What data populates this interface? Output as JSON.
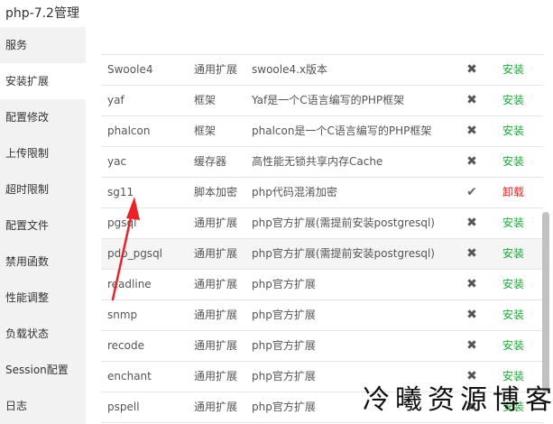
{
  "window": {
    "title": "php-7.2管理"
  },
  "sidebar": {
    "items": [
      {
        "label": "服务",
        "active": false
      },
      {
        "label": "安装扩展",
        "active": true
      },
      {
        "label": "配置修改",
        "active": false
      },
      {
        "label": "上传限制",
        "active": false
      },
      {
        "label": "超时限制",
        "active": false
      },
      {
        "label": "配置文件",
        "active": false
      },
      {
        "label": "禁用函数",
        "active": false
      },
      {
        "label": "性能调整",
        "active": false
      },
      {
        "label": "负载状态",
        "active": false
      },
      {
        "label": "Session配置",
        "active": false
      },
      {
        "label": "日志",
        "active": false
      }
    ]
  },
  "extensions": {
    "rows": [
      {
        "name": "Swoole4",
        "type": "通用扩展",
        "desc": "swoole4.x版本",
        "status_icon": "cross-icon",
        "action": "安装",
        "installed": false
      },
      {
        "name": "yaf",
        "type": "框架",
        "desc": "Yaf是一个C语言编写的PHP框架",
        "status_icon": "cross-icon",
        "action": "安装",
        "installed": false
      },
      {
        "name": "phalcon",
        "type": "框架",
        "desc": "phalcon是一个C语言编写的PHP框架",
        "status_icon": "cross-icon",
        "action": "安装",
        "installed": false
      },
      {
        "name": "yac",
        "type": "缓存器",
        "desc": "高性能无锁共享内存Cache",
        "status_icon": "cross-icon",
        "action": "安装",
        "installed": false
      },
      {
        "name": "sg11",
        "type": "脚本加密",
        "desc": "php代码混淆加密",
        "status_icon": "check-icon",
        "action": "卸载",
        "installed": true
      },
      {
        "name": "pgsql",
        "type": "通用扩展",
        "desc": "php官方扩展(需提前安装postgresql)",
        "status_icon": "cross-icon",
        "action": "安装",
        "installed": false
      },
      {
        "name": "pdo_pgsql",
        "type": "通用扩展",
        "desc": "php官方扩展(需提前安装postgresql)",
        "status_icon": "cross-icon",
        "action": "安装",
        "installed": false
      },
      {
        "name": "readline",
        "type": "通用扩展",
        "desc": "php官方扩展",
        "status_icon": "cross-icon",
        "action": "安装",
        "installed": false
      },
      {
        "name": "snmp",
        "type": "通用扩展",
        "desc": "php官方扩展",
        "status_icon": "cross-icon",
        "action": "安装",
        "installed": false
      },
      {
        "name": "recode",
        "type": "通用扩展",
        "desc": "php官方扩展",
        "status_icon": "cross-icon",
        "action": "安装",
        "installed": false
      },
      {
        "name": "enchant",
        "type": "通用扩展",
        "desc": "php官方扩展",
        "status_icon": "cross-icon",
        "action": "安装",
        "installed": false
      },
      {
        "name": "pspell",
        "type": "通用扩展",
        "desc": "php官方扩展",
        "status_icon": "cross-icon",
        "action": "安装",
        "installed": false
      }
    ]
  },
  "watermark": {
    "text": "冷曦资源博客"
  },
  "colors": {
    "install": "#20a53a",
    "uninstall": "#e41f1f",
    "annotation_arrow": "#e8242a"
  }
}
